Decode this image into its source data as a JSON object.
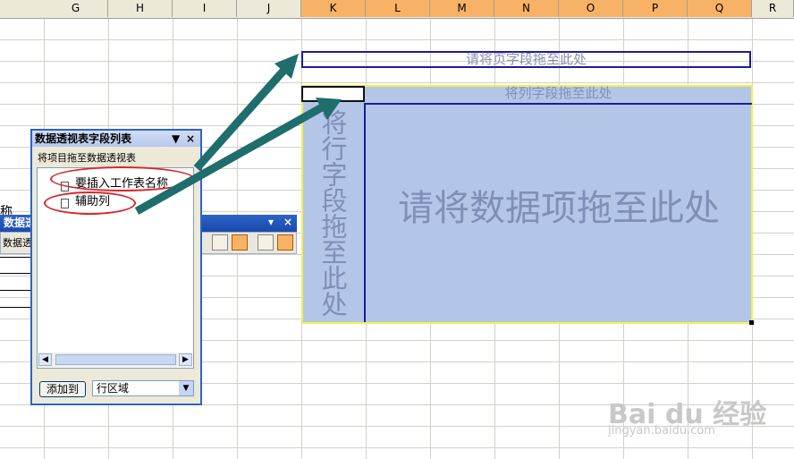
{
  "spreadsheet": {
    "columns": [
      "G",
      "H",
      "I",
      "J",
      "K",
      "L",
      "M",
      "N",
      "O",
      "P",
      "Q",
      "R"
    ],
    "selected_columns": [
      "K",
      "L",
      "M",
      "N",
      "O",
      "P",
      "Q"
    ]
  },
  "pivot": {
    "page_zone": "请将页字段拖至此处",
    "column_zone": "将列字段拖至此处",
    "row_zone": "将行字段拖至此处",
    "data_zone": "请将数据项拖至此处"
  },
  "toolbar": {
    "title": "数据透",
    "subtitle": "数据透",
    "close_glyph": "×",
    "menu_glyph": "▾"
  },
  "field_list": {
    "title": "数据透视表字段列表",
    "hint": "将项目拖至数据透视表",
    "items": [
      "要插入工作表名称",
      "辅助列"
    ],
    "add_button": "添加到",
    "area_value": "行区域",
    "menu_glyph": "▼",
    "close_glyph": "×"
  },
  "left_fragment": "称",
  "watermark": {
    "brand": "Bai du 经验",
    "url": "jingyan.baidu.com"
  },
  "colors": {
    "pivot_fill": "#b4c6e7",
    "zone_border": "#1c1c9c",
    "arrow": "#1f6d6d",
    "highlight": "#d9262a",
    "selected_header": "#f8b265"
  }
}
